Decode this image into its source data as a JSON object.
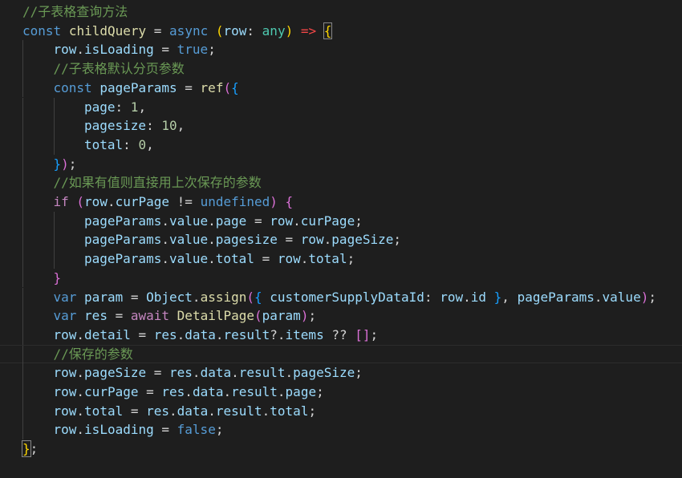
{
  "editor": {
    "language": "javascript",
    "theme": "dark",
    "colors": {
      "background": "#1e1e1e",
      "comment": "#6a9955",
      "keyword": "#569cd6",
      "control": "#c586c0",
      "variable": "#9cdcfe",
      "function": "#dcdcaa",
      "number": "#b5cea8",
      "bracket_level1": "#ffd700",
      "bracket_level2": "#da70d6",
      "bracket_level3": "#179fff"
    },
    "lines": [
      {
        "indent": 0,
        "tokens": [
          {
            "t": "//子表格查询方法",
            "c": "comment"
          }
        ]
      },
      {
        "indent": 0,
        "tokens": [
          {
            "t": "const",
            "c": "keyword"
          },
          {
            "t": " ",
            "c": "plain"
          },
          {
            "t": "childQuery",
            "c": "func"
          },
          {
            "t": " = ",
            "c": "plain"
          },
          {
            "t": "async",
            "c": "keyword"
          },
          {
            "t": " ",
            "c": "plain"
          },
          {
            "t": "(",
            "c": "b1"
          },
          {
            "t": "row",
            "c": "var"
          },
          {
            "t": ": ",
            "c": "plain"
          },
          {
            "t": "any",
            "c": "class"
          },
          {
            "t": ")",
            "c": "b1"
          },
          {
            "t": " ",
            "c": "plain"
          },
          {
            "t": "=>",
            "c": "arrow"
          },
          {
            "t": " ",
            "c": "plain"
          },
          {
            "t": "{",
            "c": "b1",
            "match": true
          }
        ]
      },
      {
        "indent": 1,
        "tokens": [
          {
            "t": "row",
            "c": "var"
          },
          {
            "t": ".",
            "c": "plain"
          },
          {
            "t": "isLoading",
            "c": "var"
          },
          {
            "t": " = ",
            "c": "plain"
          },
          {
            "t": "true",
            "c": "keyword"
          },
          {
            "t": ";",
            "c": "plain"
          }
        ]
      },
      {
        "indent": 1,
        "tokens": [
          {
            "t": "//子表格默认分页参数",
            "c": "comment"
          }
        ]
      },
      {
        "indent": 1,
        "tokens": [
          {
            "t": "const",
            "c": "keyword"
          },
          {
            "t": " ",
            "c": "plain"
          },
          {
            "t": "pageParams",
            "c": "var"
          },
          {
            "t": " = ",
            "c": "plain"
          },
          {
            "t": "ref",
            "c": "func"
          },
          {
            "t": "(",
            "c": "b2"
          },
          {
            "t": "{",
            "c": "b3"
          }
        ]
      },
      {
        "indent": 2,
        "tokens": [
          {
            "t": "page",
            "c": "var"
          },
          {
            "t": ": ",
            "c": "plain"
          },
          {
            "t": "1",
            "c": "num"
          },
          {
            "t": ",",
            "c": "plain"
          }
        ]
      },
      {
        "indent": 2,
        "tokens": [
          {
            "t": "pagesize",
            "c": "var"
          },
          {
            "t": ": ",
            "c": "plain"
          },
          {
            "t": "10",
            "c": "num"
          },
          {
            "t": ",",
            "c": "plain"
          }
        ]
      },
      {
        "indent": 2,
        "tokens": [
          {
            "t": "total",
            "c": "var"
          },
          {
            "t": ": ",
            "c": "plain"
          },
          {
            "t": "0",
            "c": "num"
          },
          {
            "t": ",",
            "c": "plain"
          }
        ]
      },
      {
        "indent": 1,
        "tokens": [
          {
            "t": "}",
            "c": "b3"
          },
          {
            "t": ")",
            "c": "b2"
          },
          {
            "t": ";",
            "c": "plain"
          }
        ]
      },
      {
        "indent": 1,
        "tokens": [
          {
            "t": "//如果有值则直接用上次保存的参数",
            "c": "comment"
          }
        ]
      },
      {
        "indent": 1,
        "tokens": [
          {
            "t": "if",
            "c": "ctrl"
          },
          {
            "t": " ",
            "c": "plain"
          },
          {
            "t": "(",
            "c": "b2"
          },
          {
            "t": "row",
            "c": "var"
          },
          {
            "t": ".",
            "c": "plain"
          },
          {
            "t": "curPage",
            "c": "var"
          },
          {
            "t": " != ",
            "c": "plain"
          },
          {
            "t": "undefined",
            "c": "keyword"
          },
          {
            "t": ")",
            "c": "b2"
          },
          {
            "t": " ",
            "c": "plain"
          },
          {
            "t": "{",
            "c": "b2"
          }
        ]
      },
      {
        "indent": 2,
        "tokens": [
          {
            "t": "pageParams",
            "c": "var"
          },
          {
            "t": ".",
            "c": "plain"
          },
          {
            "t": "value",
            "c": "var"
          },
          {
            "t": ".",
            "c": "plain"
          },
          {
            "t": "page",
            "c": "var"
          },
          {
            "t": " = ",
            "c": "plain"
          },
          {
            "t": "row",
            "c": "var"
          },
          {
            "t": ".",
            "c": "plain"
          },
          {
            "t": "curPage",
            "c": "var"
          },
          {
            "t": ";",
            "c": "plain"
          }
        ]
      },
      {
        "indent": 2,
        "tokens": [
          {
            "t": "pageParams",
            "c": "var"
          },
          {
            "t": ".",
            "c": "plain"
          },
          {
            "t": "value",
            "c": "var"
          },
          {
            "t": ".",
            "c": "plain"
          },
          {
            "t": "pagesize",
            "c": "var"
          },
          {
            "t": " = ",
            "c": "plain"
          },
          {
            "t": "row",
            "c": "var"
          },
          {
            "t": ".",
            "c": "plain"
          },
          {
            "t": "pageSize",
            "c": "var"
          },
          {
            "t": ";",
            "c": "plain"
          }
        ]
      },
      {
        "indent": 2,
        "tokens": [
          {
            "t": "pageParams",
            "c": "var"
          },
          {
            "t": ".",
            "c": "plain"
          },
          {
            "t": "value",
            "c": "var"
          },
          {
            "t": ".",
            "c": "plain"
          },
          {
            "t": "total",
            "c": "var"
          },
          {
            "t": " = ",
            "c": "plain"
          },
          {
            "t": "row",
            "c": "var"
          },
          {
            "t": ".",
            "c": "plain"
          },
          {
            "t": "total",
            "c": "var"
          },
          {
            "t": ";",
            "c": "plain"
          }
        ]
      },
      {
        "indent": 1,
        "tokens": [
          {
            "t": "}",
            "c": "b2"
          }
        ]
      },
      {
        "indent": 1,
        "tokens": [
          {
            "t": "var",
            "c": "keyword"
          },
          {
            "t": " ",
            "c": "plain"
          },
          {
            "t": "param",
            "c": "var"
          },
          {
            "t": " = ",
            "c": "plain"
          },
          {
            "t": "Object",
            "c": "var"
          },
          {
            "t": ".",
            "c": "plain"
          },
          {
            "t": "assign",
            "c": "func"
          },
          {
            "t": "(",
            "c": "b2"
          },
          {
            "t": "{",
            "c": "b3"
          },
          {
            "t": " ",
            "c": "plain"
          },
          {
            "t": "customerSupplyDataId",
            "c": "var"
          },
          {
            "t": ": ",
            "c": "plain"
          },
          {
            "t": "row",
            "c": "var"
          },
          {
            "t": ".",
            "c": "plain"
          },
          {
            "t": "id",
            "c": "var"
          },
          {
            "t": " ",
            "c": "plain"
          },
          {
            "t": "}",
            "c": "b3"
          },
          {
            "t": ", ",
            "c": "plain"
          },
          {
            "t": "pageParams",
            "c": "var"
          },
          {
            "t": ".",
            "c": "plain"
          },
          {
            "t": "value",
            "c": "var"
          },
          {
            "t": ")",
            "c": "b2"
          },
          {
            "t": ";",
            "c": "plain"
          }
        ]
      },
      {
        "indent": 1,
        "tokens": [
          {
            "t": "var",
            "c": "keyword"
          },
          {
            "t": " ",
            "c": "plain"
          },
          {
            "t": "res",
            "c": "var"
          },
          {
            "t": " = ",
            "c": "plain"
          },
          {
            "t": "await",
            "c": "ctrl"
          },
          {
            "t": " ",
            "c": "plain"
          },
          {
            "t": "DetailPage",
            "c": "func"
          },
          {
            "t": "(",
            "c": "b2"
          },
          {
            "t": "param",
            "c": "var"
          },
          {
            "t": ")",
            "c": "b2"
          },
          {
            "t": ";",
            "c": "plain"
          }
        ]
      },
      {
        "indent": 1,
        "tokens": [
          {
            "t": "row",
            "c": "var"
          },
          {
            "t": ".",
            "c": "plain"
          },
          {
            "t": "detail",
            "c": "var"
          },
          {
            "t": " = ",
            "c": "plain"
          },
          {
            "t": "res",
            "c": "var"
          },
          {
            "t": ".",
            "c": "plain"
          },
          {
            "t": "data",
            "c": "var"
          },
          {
            "t": ".",
            "c": "plain"
          },
          {
            "t": "result",
            "c": "var"
          },
          {
            "t": "?.",
            "c": "plain"
          },
          {
            "t": "items",
            "c": "var"
          },
          {
            "t": " ?? ",
            "c": "plain"
          },
          {
            "t": "[]",
            "c": "b2"
          },
          {
            "t": ";",
            "c": "plain"
          }
        ]
      },
      {
        "indent": 1,
        "current": true,
        "tokens": [
          {
            "t": "//保存的参数",
            "c": "comment"
          }
        ]
      },
      {
        "indent": 1,
        "tokens": [
          {
            "t": "row",
            "c": "var"
          },
          {
            "t": ".",
            "c": "plain"
          },
          {
            "t": "pageSize",
            "c": "var"
          },
          {
            "t": " = ",
            "c": "plain"
          },
          {
            "t": "res",
            "c": "var"
          },
          {
            "t": ".",
            "c": "plain"
          },
          {
            "t": "data",
            "c": "var"
          },
          {
            "t": ".",
            "c": "plain"
          },
          {
            "t": "result",
            "c": "var"
          },
          {
            "t": ".",
            "c": "plain"
          },
          {
            "t": "pageSize",
            "c": "var"
          },
          {
            "t": ";",
            "c": "plain"
          }
        ]
      },
      {
        "indent": 1,
        "tokens": [
          {
            "t": "row",
            "c": "var"
          },
          {
            "t": ".",
            "c": "plain"
          },
          {
            "t": "curPage",
            "c": "var"
          },
          {
            "t": " = ",
            "c": "plain"
          },
          {
            "t": "res",
            "c": "var"
          },
          {
            "t": ".",
            "c": "plain"
          },
          {
            "t": "data",
            "c": "var"
          },
          {
            "t": ".",
            "c": "plain"
          },
          {
            "t": "result",
            "c": "var"
          },
          {
            "t": ".",
            "c": "plain"
          },
          {
            "t": "page",
            "c": "var"
          },
          {
            "t": ";",
            "c": "plain"
          }
        ]
      },
      {
        "indent": 1,
        "tokens": [
          {
            "t": "row",
            "c": "var"
          },
          {
            "t": ".",
            "c": "plain"
          },
          {
            "t": "total",
            "c": "var"
          },
          {
            "t": " = ",
            "c": "plain"
          },
          {
            "t": "res",
            "c": "var"
          },
          {
            "t": ".",
            "c": "plain"
          },
          {
            "t": "data",
            "c": "var"
          },
          {
            "t": ".",
            "c": "plain"
          },
          {
            "t": "result",
            "c": "var"
          },
          {
            "t": ".",
            "c": "plain"
          },
          {
            "t": "total",
            "c": "var"
          },
          {
            "t": ";",
            "c": "plain"
          }
        ]
      },
      {
        "indent": 1,
        "tokens": [
          {
            "t": "row",
            "c": "var"
          },
          {
            "t": ".",
            "c": "plain"
          },
          {
            "t": "isLoading",
            "c": "var"
          },
          {
            "t": " = ",
            "c": "plain"
          },
          {
            "t": "false",
            "c": "keyword"
          },
          {
            "t": ";",
            "c": "plain"
          }
        ]
      },
      {
        "indent": 0,
        "tokens": [
          {
            "t": "}",
            "c": "b1",
            "match": true
          },
          {
            "t": ";",
            "c": "plain"
          }
        ]
      }
    ]
  }
}
